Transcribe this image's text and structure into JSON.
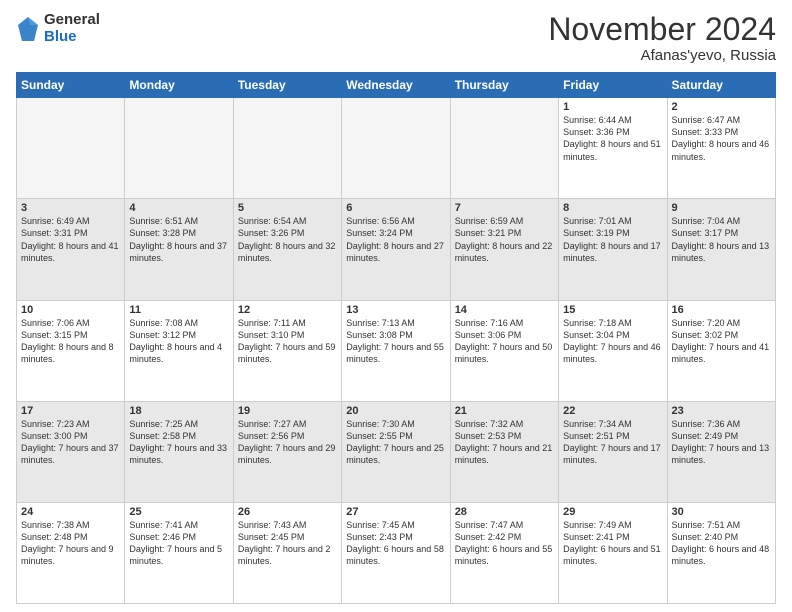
{
  "logo": {
    "general": "General",
    "blue": "Blue"
  },
  "header": {
    "month": "November 2024",
    "location": "Afanas'yevo, Russia"
  },
  "weekdays": [
    "Sunday",
    "Monday",
    "Tuesday",
    "Wednesday",
    "Thursday",
    "Friday",
    "Saturday"
  ],
  "weeks": [
    [
      {
        "day": "",
        "info": ""
      },
      {
        "day": "",
        "info": ""
      },
      {
        "day": "",
        "info": ""
      },
      {
        "day": "",
        "info": ""
      },
      {
        "day": "",
        "info": ""
      },
      {
        "day": "1",
        "info": "Sunrise: 6:44 AM\nSunset: 3:36 PM\nDaylight: 8 hours and 51 minutes."
      },
      {
        "day": "2",
        "info": "Sunrise: 6:47 AM\nSunset: 3:33 PM\nDaylight: 8 hours and 46 minutes."
      }
    ],
    [
      {
        "day": "3",
        "info": "Sunrise: 6:49 AM\nSunset: 3:31 PM\nDaylight: 8 hours and 41 minutes."
      },
      {
        "day": "4",
        "info": "Sunrise: 6:51 AM\nSunset: 3:28 PM\nDaylight: 8 hours and 37 minutes."
      },
      {
        "day": "5",
        "info": "Sunrise: 6:54 AM\nSunset: 3:26 PM\nDaylight: 8 hours and 32 minutes."
      },
      {
        "day": "6",
        "info": "Sunrise: 6:56 AM\nSunset: 3:24 PM\nDaylight: 8 hours and 27 minutes."
      },
      {
        "day": "7",
        "info": "Sunrise: 6:59 AM\nSunset: 3:21 PM\nDaylight: 8 hours and 22 minutes."
      },
      {
        "day": "8",
        "info": "Sunrise: 7:01 AM\nSunset: 3:19 PM\nDaylight: 8 hours and 17 minutes."
      },
      {
        "day": "9",
        "info": "Sunrise: 7:04 AM\nSunset: 3:17 PM\nDaylight: 8 hours and 13 minutes."
      }
    ],
    [
      {
        "day": "10",
        "info": "Sunrise: 7:06 AM\nSunset: 3:15 PM\nDaylight: 8 hours and 8 minutes."
      },
      {
        "day": "11",
        "info": "Sunrise: 7:08 AM\nSunset: 3:12 PM\nDaylight: 8 hours and 4 minutes."
      },
      {
        "day": "12",
        "info": "Sunrise: 7:11 AM\nSunset: 3:10 PM\nDaylight: 7 hours and 59 minutes."
      },
      {
        "day": "13",
        "info": "Sunrise: 7:13 AM\nSunset: 3:08 PM\nDaylight: 7 hours and 55 minutes."
      },
      {
        "day": "14",
        "info": "Sunrise: 7:16 AM\nSunset: 3:06 PM\nDaylight: 7 hours and 50 minutes."
      },
      {
        "day": "15",
        "info": "Sunrise: 7:18 AM\nSunset: 3:04 PM\nDaylight: 7 hours and 46 minutes."
      },
      {
        "day": "16",
        "info": "Sunrise: 7:20 AM\nSunset: 3:02 PM\nDaylight: 7 hours and 41 minutes."
      }
    ],
    [
      {
        "day": "17",
        "info": "Sunrise: 7:23 AM\nSunset: 3:00 PM\nDaylight: 7 hours and 37 minutes."
      },
      {
        "day": "18",
        "info": "Sunrise: 7:25 AM\nSunset: 2:58 PM\nDaylight: 7 hours and 33 minutes."
      },
      {
        "day": "19",
        "info": "Sunrise: 7:27 AM\nSunset: 2:56 PM\nDaylight: 7 hours and 29 minutes."
      },
      {
        "day": "20",
        "info": "Sunrise: 7:30 AM\nSunset: 2:55 PM\nDaylight: 7 hours and 25 minutes."
      },
      {
        "day": "21",
        "info": "Sunrise: 7:32 AM\nSunset: 2:53 PM\nDaylight: 7 hours and 21 minutes."
      },
      {
        "day": "22",
        "info": "Sunrise: 7:34 AM\nSunset: 2:51 PM\nDaylight: 7 hours and 17 minutes."
      },
      {
        "day": "23",
        "info": "Sunrise: 7:36 AM\nSunset: 2:49 PM\nDaylight: 7 hours and 13 minutes."
      }
    ],
    [
      {
        "day": "24",
        "info": "Sunrise: 7:38 AM\nSunset: 2:48 PM\nDaylight: 7 hours and 9 minutes."
      },
      {
        "day": "25",
        "info": "Sunrise: 7:41 AM\nSunset: 2:46 PM\nDaylight: 7 hours and 5 minutes."
      },
      {
        "day": "26",
        "info": "Sunrise: 7:43 AM\nSunset: 2:45 PM\nDaylight: 7 hours and 2 minutes."
      },
      {
        "day": "27",
        "info": "Sunrise: 7:45 AM\nSunset: 2:43 PM\nDaylight: 6 hours and 58 minutes."
      },
      {
        "day": "28",
        "info": "Sunrise: 7:47 AM\nSunset: 2:42 PM\nDaylight: 6 hours and 55 minutes."
      },
      {
        "day": "29",
        "info": "Sunrise: 7:49 AM\nSunset: 2:41 PM\nDaylight: 6 hours and 51 minutes."
      },
      {
        "day": "30",
        "info": "Sunrise: 7:51 AM\nSunset: 2:40 PM\nDaylight: 6 hours and 48 minutes."
      }
    ]
  ]
}
